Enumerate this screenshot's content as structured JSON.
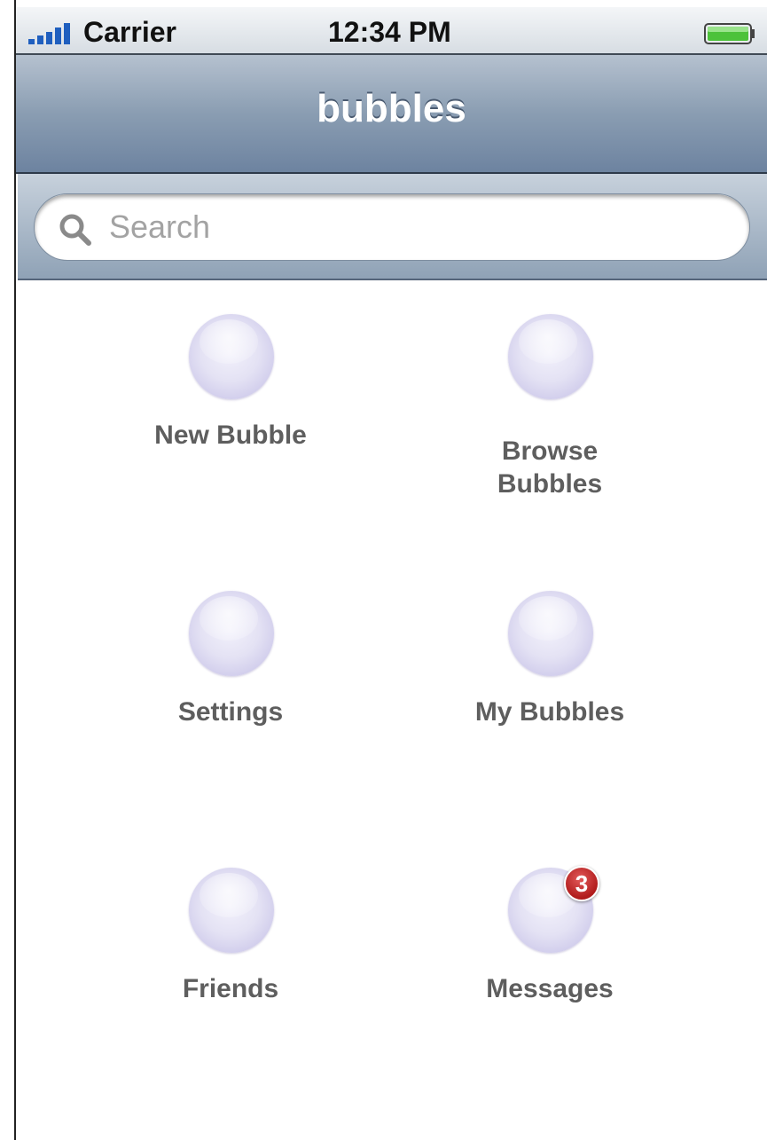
{
  "status_bar": {
    "carrier": "Carrier",
    "time": "12:34 PM",
    "signal_icon": "signal-bars-icon",
    "battery_icon": "battery-icon",
    "battery_color": "#4cc23a"
  },
  "nav_bar": {
    "title": "bubbles"
  },
  "search": {
    "placeholder": "Search",
    "icon": "search-icon"
  },
  "menu": {
    "items": [
      {
        "label": "New Bubble",
        "icon": "bubble-icon"
      },
      {
        "label": "Browse Bubbles",
        "icon": "bubble-icon"
      },
      {
        "label": "Settings",
        "icon": "bubble-icon"
      },
      {
        "label": "My Bubbles",
        "icon": "bubble-icon"
      },
      {
        "label": "Friends",
        "icon": "bubble-icon"
      },
      {
        "label": "Messages",
        "icon": "bubble-icon",
        "badge": "3"
      }
    ]
  },
  "colors": {
    "nav_bar": "#7f93aa",
    "label": "#5e5e5e",
    "bubble": "#d8d5f0",
    "badge": "#c0262b"
  }
}
